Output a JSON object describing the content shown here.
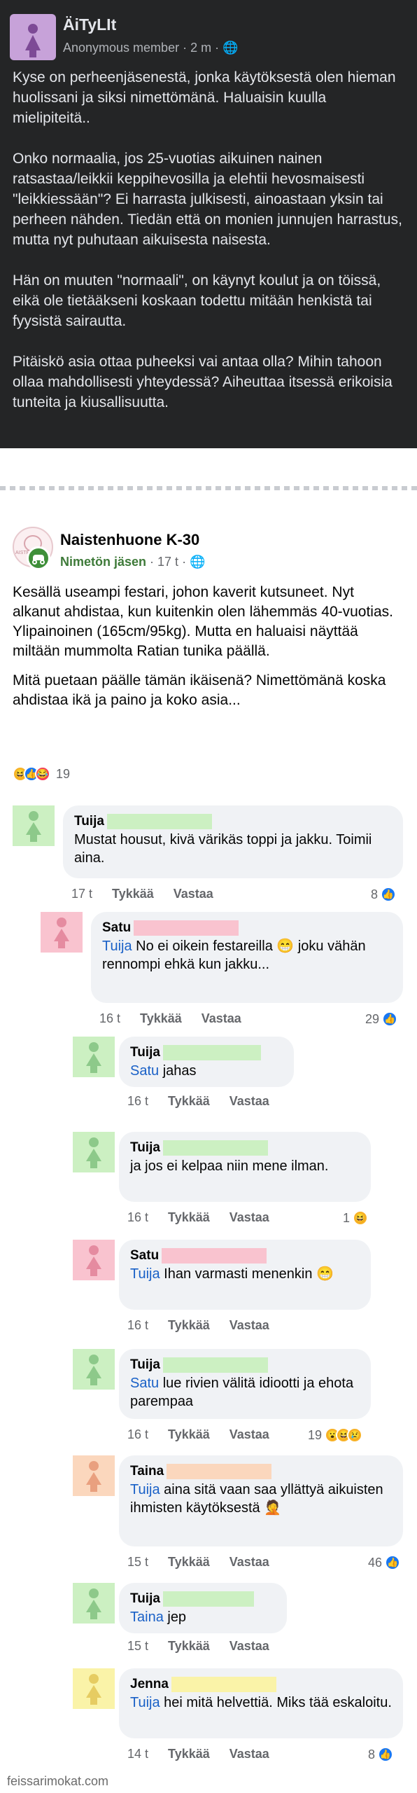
{
  "dark_post": {
    "author": "ÄiTyLIt",
    "role": "Anonymous member",
    "time": "2 m",
    "paragraphs": [
      "Kyse on perheenjäsenestä, jonka käytöksestä olen hieman huolissani ja siksi nimettömänä. Haluaisin kuulla mielipiteitä..",
      "Onko normaalia, jos 25-vuotias aikuinen nainen ratsastaa/leikkii keppihevosilla ja elehtii hevosmaisesti \"leikkiessään\"? Ei harrasta julkisesti, ainoastaan yksin tai perheen nähden. Tiedän että on monien junnujen harrastus, mutta nyt puhutaan aikuisesta naisesta.",
      "Hän on muuten \"normaali\", on käynyt koulut ja on töissä, eikä ole tietääkseni koskaan todettu mitään henkistä tai fyysistä sairautta.",
      "Pitäiskö asia ottaa puheeksi vai antaa olla? Mihin tahoon ollaa mahdollisesti yhteydessä? Aiheuttaa itsessä erikoisia tunteita ja kiusallisuutta."
    ],
    "avatar_color": "#c7a2d9"
  },
  "post": {
    "group": "Naistenhuone K-30",
    "member": "Nimetön jäsen",
    "time": "17 t",
    "logo_text": "AISTE",
    "paragraphs": [
      "Kesällä useampi festari, johon kaverit kutsuneet. Nyt alkanut ahdistaa, kun kuitenkin olen lähemmäs 40-vuotias. Ylipainoinen (165cm/95kg). Mutta en haluaisi näyttää miltään mummolta Ratian tunika päällä.",
      "Mitä puetaan päälle tämän ikäisenä? Nimettömänä koska ahdistaa ikä ja paino ja koko asia..."
    ],
    "reaction_count": "19",
    "reaction_icons": [
      "haha-icon",
      "like-icon",
      "love-icon"
    ]
  },
  "labels": {
    "like": "Tykkää",
    "reply": "Vastaa"
  },
  "comments": [
    {
      "author": "Tuija",
      "mention": "",
      "text": "Mustat housut, kivä värikäs toppi ja  jakku. Toimii aina.",
      "time": "17 t",
      "likes": "8",
      "color": "#8dc98a",
      "hide": "#ccf0c2"
    },
    {
      "author": "Satu",
      "mention": "Tuija",
      "text": " No ei oikein festareilla 😁 joku vähän rennompi ehkä kun jakku...",
      "time": "16 t",
      "likes": "29",
      "color": "#e58ba0",
      "hide": "#f9c3cf"
    },
    {
      "author": "Tuija",
      "mention": "Satu",
      "text": " jahas",
      "time": "16 t",
      "likes": "",
      "color": "#8dc98a",
      "hide": "#ccf0c2"
    },
    {
      "author": "Tuija",
      "mention": "",
      "text": " ja jos ei kelpaa niin mene ilman.",
      "time": "16 t",
      "likes": "1",
      "color": "#8dc98a",
      "hide": "#ccf0c2"
    },
    {
      "author": "Satu",
      "mention": "Tuija",
      "text": " Ihan varmasti menenkin 😁",
      "time": "16 t",
      "likes": "",
      "color": "#e58ba0",
      "hide": "#f9c3cf"
    },
    {
      "author": "Tuija",
      "mention": "Satu",
      "text": " lue rivien välitä idiootti ja ehota parempaa",
      "time": "16 t",
      "likes": "19",
      "color": "#8dc98a",
      "hide": "#ccf0c2"
    },
    {
      "author": "Taina",
      "mention": "Tuija",
      "text": " aina sitä vaan saa yllättyä aikuisten ihmisten käytöksestä 🤦",
      "time": "15 t",
      "likes": "46",
      "color": "#e9a07f",
      "hide": "#fbd7bd"
    },
    {
      "author": "Tuija",
      "mention": "Taina",
      "text": " jep",
      "time": "15 t",
      "likes": "",
      "color": "#8dc98a",
      "hide": "#ccf0c2"
    },
    {
      "author": "Jenna",
      "mention": "Tuija",
      "text": " hei mitä helvettiä. Miks tää eskaloitu.",
      "time": "14 t",
      "likes": "8",
      "color": "#e6cc62",
      "hide": "#faf3a8"
    }
  ],
  "footer": "feissarimokat.com"
}
